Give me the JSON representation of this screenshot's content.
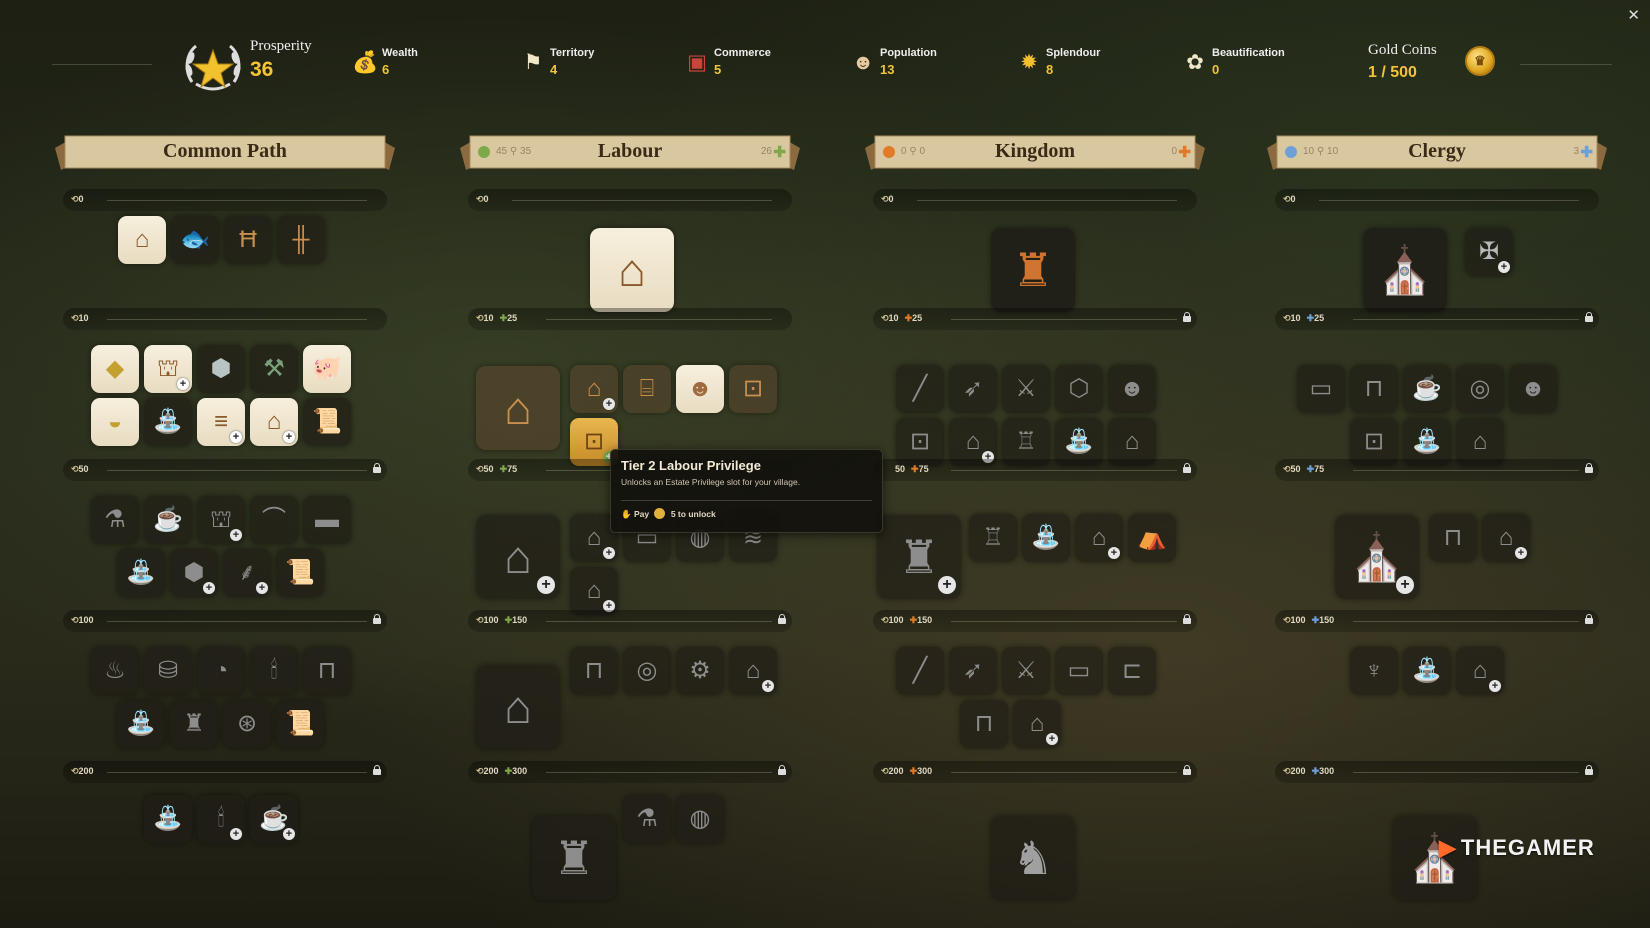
{
  "header": {
    "prosperity": {
      "label": "Prosperity",
      "value": "36"
    },
    "stats": [
      {
        "key": "wealth",
        "label": "Wealth",
        "value": "6",
        "icon": "coin-sack-icon"
      },
      {
        "key": "territory",
        "label": "Territory",
        "value": "4",
        "icon": "flag-icon"
      },
      {
        "key": "commerce",
        "label": "Commerce",
        "value": "5",
        "icon": "crate-icon"
      },
      {
        "key": "population",
        "label": "Population",
        "value": "13",
        "icon": "villager-icon"
      },
      {
        "key": "splendour",
        "label": "Splendour",
        "value": "8",
        "icon": "sun-icon"
      },
      {
        "key": "beautification",
        "label": "Beautification",
        "value": "0",
        "icon": "flower-icon"
      }
    ],
    "gold": {
      "label": "Gold Coins",
      "value": "1 / 500"
    }
  },
  "colors": {
    "accent": "#f1c43a",
    "banner": "#d9c7a0",
    "labour": "#7fa84b",
    "kingdom": "#e07a2a",
    "clergy": "#6ea0d8"
  },
  "columns": {
    "common": {
      "title": "Common Path",
      "tiers": [
        {
          "req": "0"
        },
        {
          "req": "10"
        },
        {
          "req": "50"
        },
        {
          "req": "100"
        },
        {
          "req": "200"
        }
      ]
    },
    "labour": {
      "title": "Labour",
      "left_info": "45 ⚲ 35",
      "right_info": "26",
      "tiers": [
        {
          "req": "0",
          "sub": ""
        },
        {
          "req": "10",
          "sub": "25"
        },
        {
          "req": "50",
          "sub": "75"
        },
        {
          "req": "100",
          "sub": "150"
        },
        {
          "req": "200",
          "sub": "300"
        }
      ]
    },
    "kingdom": {
      "title": "Kingdom",
      "left_info": "0 ⚲ 0",
      "right_info": "0",
      "tiers": [
        {
          "req": "0",
          "sub": ""
        },
        {
          "req": "10",
          "sub": "25"
        },
        {
          "req": "50",
          "sub": "75"
        },
        {
          "req": "100",
          "sub": "150"
        },
        {
          "req": "200",
          "sub": "300"
        }
      ]
    },
    "clergy": {
      "title": "Clergy",
      "left_info": "10 ⚲ 10",
      "right_info": "3",
      "tiers": [
        {
          "req": "0",
          "sub": ""
        },
        {
          "req": "10",
          "sub": "25"
        },
        {
          "req": "50",
          "sub": "75"
        },
        {
          "req": "100",
          "sub": "150"
        },
        {
          "req": "200",
          "sub": "300"
        }
      ]
    }
  },
  "tooltip": {
    "title": "Tier 2 Labour Privilege",
    "description": "Unlocks an Estate Privilege slot for your village.",
    "pay_label": "Pay",
    "cost_text": "5 to unlock"
  },
  "watermark": "THEGAMER"
}
